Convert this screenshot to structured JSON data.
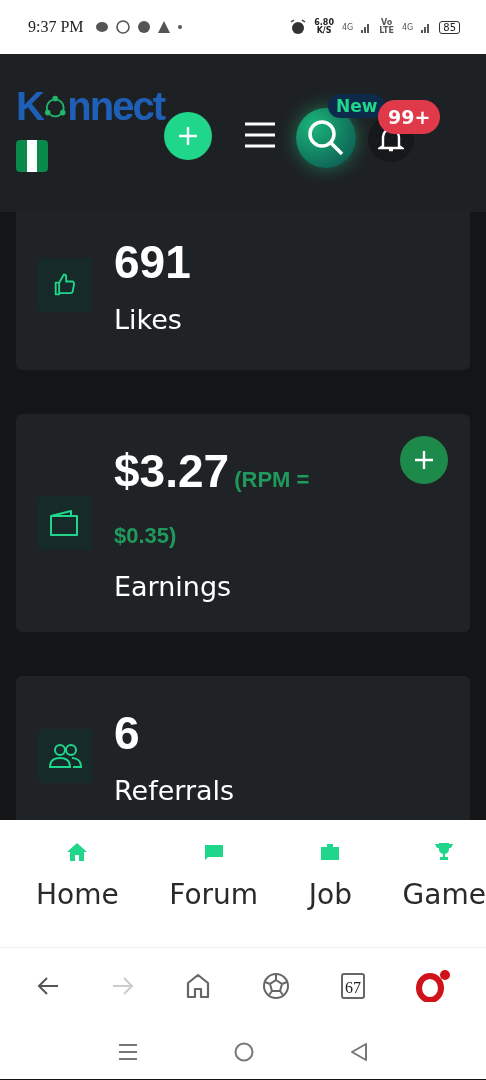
{
  "status_bar": {
    "time": "9:37 PM",
    "speed": "6.80",
    "speed_unit": "K/S",
    "network_1": "4G",
    "volte_top": "Vo",
    "volte_bottom": "LTE",
    "network_2": "4G",
    "battery": "85"
  },
  "header": {
    "logo_start": "K",
    "logo_end": "nnect",
    "search_badge": "New",
    "notification_count": "99+"
  },
  "stats": [
    {
      "kind": "thumb",
      "value": "691",
      "label": "Likes"
    },
    {
      "kind": "wallet",
      "value": "$3.27",
      "note": "(RPM = $0.35)",
      "label": "Earnings",
      "add_button": true
    },
    {
      "kind": "people",
      "value": "6",
      "label": "Referrals"
    }
  ],
  "bottom_nav": [
    {
      "kind": "home",
      "label": "Home"
    },
    {
      "kind": "chat",
      "label": "Forum"
    },
    {
      "kind": "briefcase",
      "label": "Job"
    },
    {
      "kind": "trophy",
      "label": "Game"
    }
  ],
  "browser_bar": {
    "tab_count": "67"
  }
}
